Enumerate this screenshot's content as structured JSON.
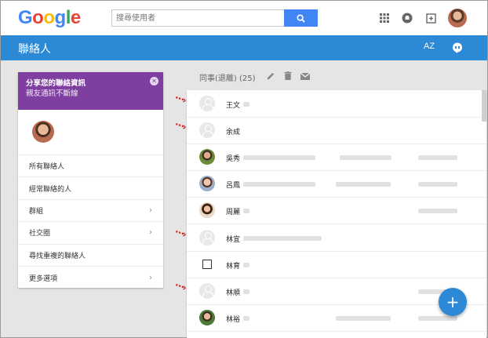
{
  "header": {
    "logo": [
      "G",
      "o",
      "o",
      "g",
      "l",
      "e"
    ],
    "logo_colors": [
      "#4285f4",
      "#ea4335",
      "#fbbc05",
      "#4285f4",
      "#34a853",
      "#ea4335"
    ],
    "search_placeholder": "搜尋使用者"
  },
  "toolbar": {
    "title": "聯絡人",
    "sort_label": "AZ"
  },
  "promo": {
    "line1": "分享您的聯絡資訊",
    "line2": "親友通訊不斷線",
    "close": "✕"
  },
  "sidebar": {
    "items": [
      {
        "label": "所有聯絡人",
        "chevron": ""
      },
      {
        "label": "經常聯絡的人",
        "chevron": ""
      },
      {
        "label": "群組",
        "chevron": "›"
      },
      {
        "label": "社交圈",
        "chevron": "›"
      },
      {
        "label": "尋找重複的聯絡人",
        "chevron": ""
      },
      {
        "label": "更多選項",
        "chevron": "›"
      }
    ]
  },
  "group": {
    "title": "同事(退離) (25)"
  },
  "contacts": [
    {
      "name": "王文",
      "avatar": "blank",
      "arrow": true
    },
    {
      "name": "余成",
      "avatar": "blank",
      "arrow": true
    },
    {
      "name": "吳秀",
      "avatar": "p1",
      "arrow": false
    },
    {
      "name": "呂鳳",
      "avatar": "p2",
      "arrow": false
    },
    {
      "name": "周麗",
      "avatar": "p3",
      "arrow": false
    },
    {
      "name": "林宜",
      "avatar": "blank",
      "arrow": true
    },
    {
      "name": "林育",
      "avatar": "checkbox",
      "arrow": false
    },
    {
      "name": "林順",
      "avatar": "blank",
      "arrow": true
    },
    {
      "name": "林裕",
      "avatar": "p4",
      "arrow": false
    }
  ],
  "fab_label": "+",
  "colors": {
    "accent": "#2b89d6",
    "promo": "#7e3fa0",
    "arrow": "#d81b1b"
  }
}
